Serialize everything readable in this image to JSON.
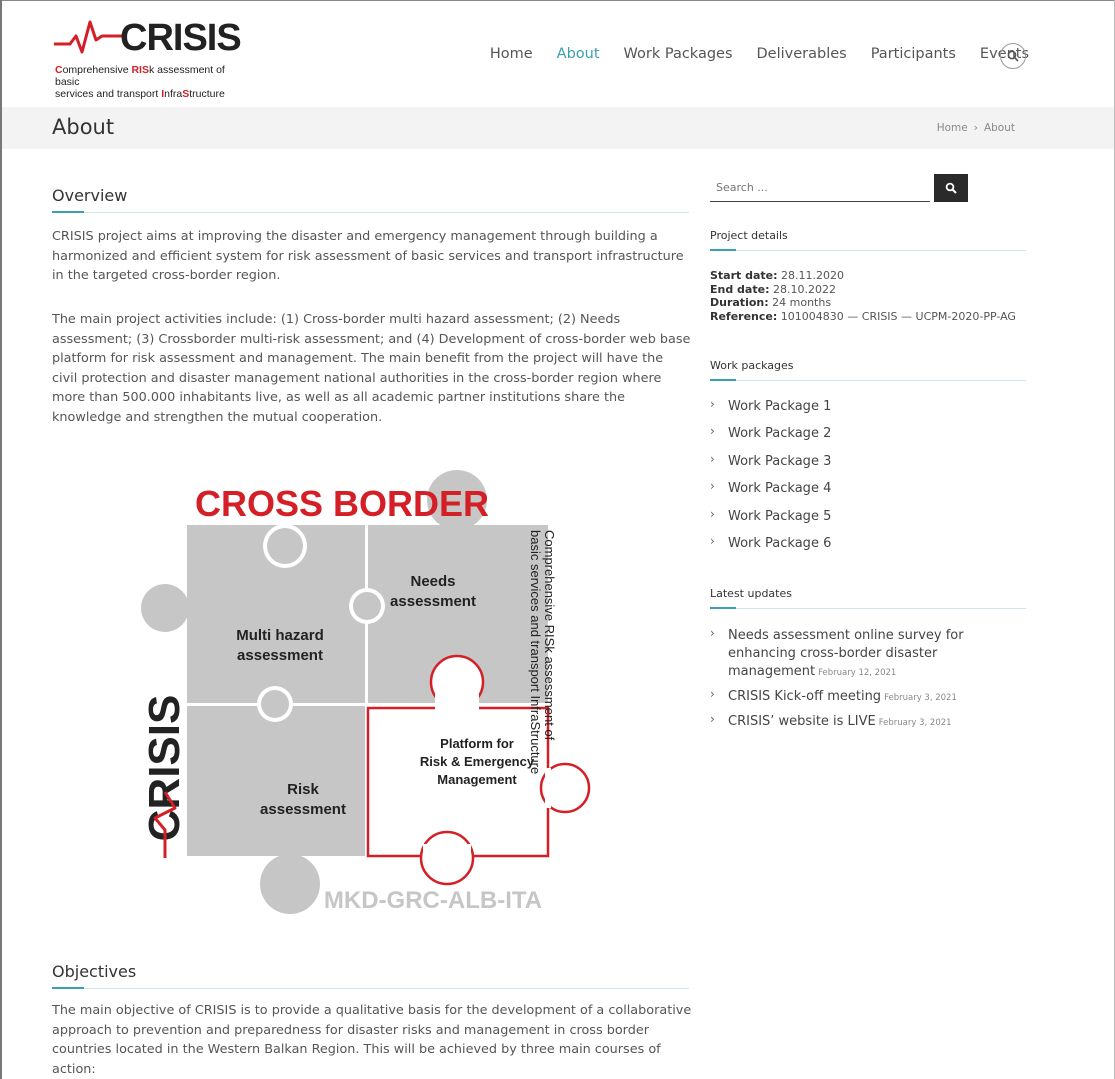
{
  "logo": {
    "word": "CRISIS",
    "sub_line1_a": "C",
    "sub_line1_b": "omprehensive ",
    "sub_line1_c": "RIS",
    "sub_line1_d": "k assessment of basic",
    "sub_line2_a": "services and transport ",
    "sub_line2_b": "I",
    "sub_line2_c": "nfra",
    "sub_line2_d": "S",
    "sub_line2_e": "tructure"
  },
  "nav": {
    "home": "Home",
    "about": "About",
    "work_packages": "Work Packages",
    "deliverables": "Deliverables",
    "participants": "Participants",
    "events": "Events"
  },
  "page": {
    "title": "About",
    "breadcrumb_home": "Home",
    "breadcrumb_sep": "›",
    "breadcrumb_current": "About"
  },
  "overview": {
    "heading": "Overview",
    "p1": "CRISIS project aims at improving the disaster and emergency management through building a harmonized and efficient system for risk assessment of basic services and transport infrastructure in the targeted cross-border region.",
    "p2": "The main project activities include: (1) Cross-border multi hazard assessment; (2) Needs assessment; (3) Crossborder multi-risk assessment; and (4) Development of cross-border web base platform for risk assessment and management. The main benefit from the project will have the civil protection and disaster management national authorities in the cross-border region where more than 500.000 inhabitants live, as well as all academic partner institutions share the knowledge and strengthen the mutual cooperation."
  },
  "puzzle": {
    "cross_border": "CROSS BORDER",
    "crisis": "CRISIS",
    "piece1_l1": "Multi hazard",
    "piece1_l2": "assessment",
    "piece2_l1": "Needs",
    "piece2_l2": "assessment",
    "piece3_l1": "Risk",
    "piece3_l2": "assessment",
    "piece4_l1": "Platform for",
    "piece4_l2": "Risk & Emergency",
    "piece4_l3": "Management",
    "countries": "MKD-GRC-ALB-ITA",
    "vertical_l1": "Comprehensive RISk assessment of",
    "vertical_l2": "basic services and transport InfraStructure"
  },
  "objectives": {
    "heading": "Objectives",
    "p1": "The main objective of CRISIS is to provide a qualitative basis for the development of a collaborative approach to prevention and preparedness for disaster risks and management in cross border countries located in the Western Balkan Region. This will be achieved by three main courses of action:"
  },
  "sidebar": {
    "search_placeholder": "Search ...",
    "project_details_heading": "Project details",
    "start_label": "Start date:",
    "start_value": "28.11.2020",
    "end_label": "End date:",
    "end_value": "28.10.2022",
    "duration_label": "Duration:",
    "duration_value": "24 months",
    "reference_label": "Reference:",
    "reference_value": "101004830 — CRISIS — UCPM-2020-PP-AG",
    "work_packages_heading": "Work packages",
    "work_packages": [
      "Work Package 1",
      "Work Package 2",
      "Work Package 3",
      "Work Package 4",
      "Work Package 5",
      "Work Package 6"
    ],
    "latest_updates_heading": "Latest updates",
    "updates": [
      {
        "title": "Needs assessment online survey for enhancing cross-border disaster management",
        "date": "February 12, 2021"
      },
      {
        "title": "CRISIS Kick-off meeting",
        "date": "February 3, 2021"
      },
      {
        "title": "CRISIS’ website is LIVE",
        "date": "February 3, 2021"
      }
    ]
  },
  "colors": {
    "accent": "#3a9fb0",
    "brand_red": "#d41f26",
    "puzzle_gray": "#c6c6c6",
    "title_bar": "#f3f3f3"
  },
  "icons": [
    "search-icon",
    "chevron-right-icon",
    "heartbeat-icon"
  ]
}
